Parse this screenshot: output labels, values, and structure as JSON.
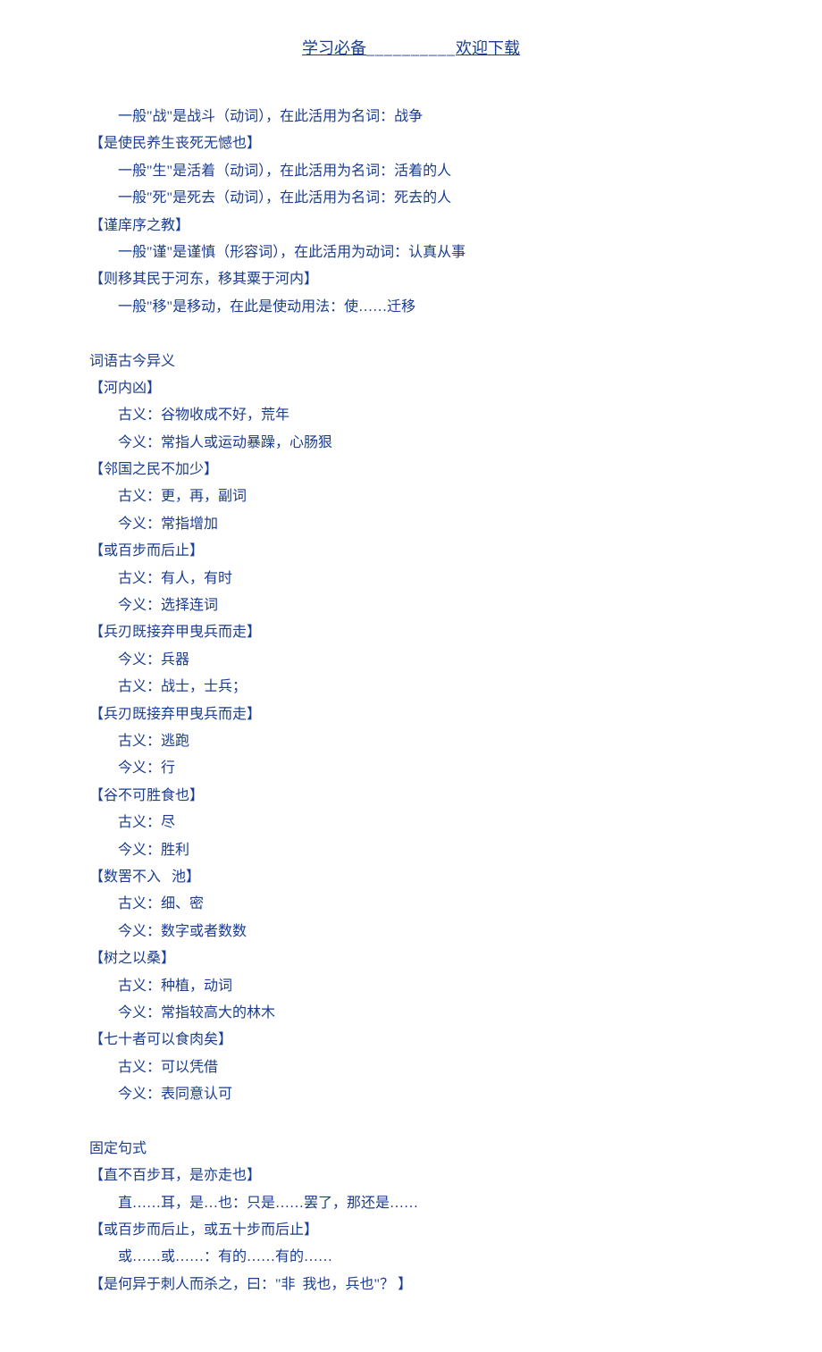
{
  "header": {
    "left": "学习必备",
    "dashes": "__________",
    "right": "欢迎下载"
  },
  "block1": [
    {
      "text": "一般\"战\"是战斗（动词），在此活用为名词：战争",
      "indent": true
    },
    {
      "text": "【是使民养生丧死无憾也】",
      "indent": false
    },
    {
      "text": "一般\"生\"是活着（动词），在此活用为名词：活着的人",
      "indent": true
    },
    {
      "text": "一般\"死\"是死去（动词），在此活用为名词：死去的人",
      "indent": true
    },
    {
      "text": "【谨庠序之教】",
      "indent": false
    },
    {
      "text": "一般\"谨\"是谨慎（形容词），在此活用为动词：认真从事",
      "indent": true
    },
    {
      "text": "【则移其民于河东，移其粟于河内】",
      "indent": false
    },
    {
      "text": "一般\"移\"是移动，在此是使动用法：使……迁移",
      "indent": true
    }
  ],
  "block2_title": "词语古今异义",
  "block2": [
    {
      "text": "【河内凶】",
      "indent": false
    },
    {
      "text": "古义：谷物收成不好，荒年",
      "indent": true
    },
    {
      "text": "今义：常指人或运动暴躁，心肠狠",
      "indent": true
    },
    {
      "text": "【邻国之民不加少】",
      "indent": false
    },
    {
      "text": "古义：更，再，副词",
      "indent": true
    },
    {
      "text": "今义：常指增加",
      "indent": true
    },
    {
      "text": "【或百步而后止】",
      "indent": false
    },
    {
      "text": "古义：有人，有时",
      "indent": true
    },
    {
      "text": "今义：选择连词",
      "indent": true
    },
    {
      "text": "【兵刃既接弃甲曳兵而走】",
      "indent": false
    },
    {
      "text": "今义：兵器",
      "indent": true
    },
    {
      "text": "古义：战士，士兵；",
      "indent": true
    },
    {
      "text": "【兵刃既接弃甲曳兵而走】",
      "indent": false
    },
    {
      "text": "古义：逃跑",
      "indent": true
    },
    {
      "text": "今义：行",
      "indent": true
    },
    {
      "text": "【谷不可胜食也】",
      "indent": false
    },
    {
      "text": "古义：尽",
      "indent": true
    },
    {
      "text": "今义：胜利",
      "indent": true
    },
    {
      "text": "【数罟不入   池】",
      "indent": false
    },
    {
      "text": "古义：细、密",
      "indent": true
    },
    {
      "text": "今义：数字或者数数",
      "indent": true
    },
    {
      "text": "【树之以桑】",
      "indent": false
    },
    {
      "text": "古义：种植，动词",
      "indent": true
    },
    {
      "text": "今义：常指较高大的林木",
      "indent": true
    },
    {
      "text": "【七十者可以食肉矣】",
      "indent": false
    },
    {
      "text": "古义：可以凭借",
      "indent": true
    },
    {
      "text": "今义：表同意认可",
      "indent": true
    }
  ],
  "block3_title": "固定句式",
  "block3": [
    {
      "text": "【直不百步耳，是亦走也】",
      "indent": false
    },
    {
      "text": "直……耳，是…也：只是……罢了，那还是……",
      "indent": true
    },
    {
      "text": "【或百步而后止，或五十步而后止】",
      "indent": false
    },
    {
      "text": "或……或……：有的……有的……",
      "indent": true
    },
    {
      "text": "【是何异于刺人而杀之，曰：\"非  我也，兵也\"？ 】",
      "indent": false
    }
  ]
}
